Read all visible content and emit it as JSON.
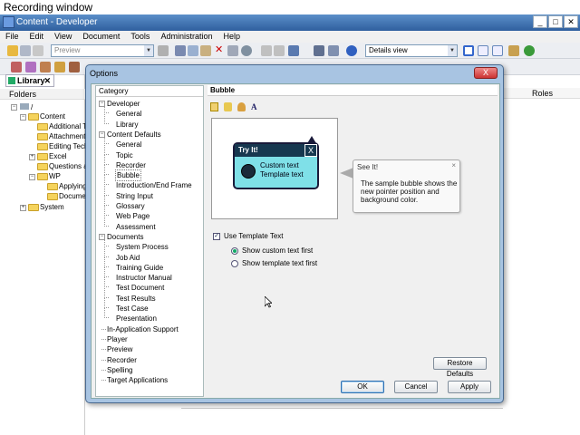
{
  "recording_title": "Recording window",
  "app": {
    "title": "Content - Developer",
    "window_buttons": [
      "_",
      "□",
      "✕"
    ]
  },
  "menu": [
    "File",
    "Edit",
    "View",
    "Document",
    "Tools",
    "Administration",
    "Help"
  ],
  "toolbar": {
    "preview_combo": "Preview",
    "view_combo": "Details view"
  },
  "library_tab": "Library",
  "folders_header": "Folders",
  "folders": [
    {
      "label": "/",
      "level": 0
    },
    {
      "label": "Content",
      "level": 1
    },
    {
      "label": "Additional Top",
      "level": 2
    },
    {
      "label": "Attachments",
      "level": 2
    },
    {
      "label": "Editing Techni",
      "level": 2
    },
    {
      "label": "Excel",
      "level": 2
    },
    {
      "label": "Questions and",
      "level": 2
    },
    {
      "label": "WP",
      "level": 2
    },
    {
      "label": "Applying F",
      "level": 3
    },
    {
      "label": "Document",
      "level": 3
    },
    {
      "label": "System",
      "level": 1
    }
  ],
  "roles_header": "Roles",
  "dialog": {
    "title": "Options",
    "close": "X",
    "category_header": "Category",
    "categories": [
      {
        "label": "Developer",
        "indent": 0
      },
      {
        "label": "General",
        "indent": 1
      },
      {
        "label": "Library",
        "indent": 1
      },
      {
        "label": "Content Defaults",
        "indent": 0
      },
      {
        "label": "General",
        "indent": 1
      },
      {
        "label": "Topic",
        "indent": 1
      },
      {
        "label": "Recorder",
        "indent": 1
      },
      {
        "label": "Bubble",
        "indent": 1
      },
      {
        "label": "Introduction/End Frame",
        "indent": 1
      },
      {
        "label": "String Input",
        "indent": 1
      },
      {
        "label": "Glossary",
        "indent": 1
      },
      {
        "label": "Web Page",
        "indent": 1
      },
      {
        "label": "Assessment",
        "indent": 1
      },
      {
        "label": "Documents",
        "indent": 0
      },
      {
        "label": "System Process",
        "indent": 1
      },
      {
        "label": "Job Aid",
        "indent": 1
      },
      {
        "label": "Training Guide",
        "indent": 1
      },
      {
        "label": "Instructor Manual",
        "indent": 1
      },
      {
        "label": "Test Document",
        "indent": 1
      },
      {
        "label": "Test Results",
        "indent": 1
      },
      {
        "label": "Test Case",
        "indent": 1
      },
      {
        "label": "Presentation",
        "indent": 1
      },
      {
        "label": "In-Application Support",
        "indent": 0
      },
      {
        "label": "Player",
        "indent": 0
      },
      {
        "label": "Preview",
        "indent": 0
      },
      {
        "label": "Recorder",
        "indent": 0
      },
      {
        "label": "Spelling",
        "indent": 0
      },
      {
        "label": "Target Applications",
        "indent": 0
      }
    ],
    "selected_category": "Bubble",
    "page_header": "Bubble",
    "sample_bubble": {
      "title": "Try It!",
      "close": "X",
      "line1": "Custom text",
      "line2": "Template text"
    },
    "see_it_bubble": {
      "title": "See It!",
      "close": "×",
      "text": "The sample bubble shows the new pointer position and background color."
    },
    "use_template_text": {
      "label": "Use Template Text",
      "checked": true
    },
    "radios": [
      {
        "label": "Show custom text first",
        "selected": true
      },
      {
        "label": "Show template text first",
        "selected": false
      }
    ],
    "restore_defaults": "Restore Defaults",
    "ok": "OK",
    "cancel": "Cancel",
    "apply": "Apply"
  },
  "colors": {
    "bubble_bg": "#7fe0e8",
    "bubble_title_bg": "#173850",
    "dialog_frame": "#a8c4e2"
  }
}
